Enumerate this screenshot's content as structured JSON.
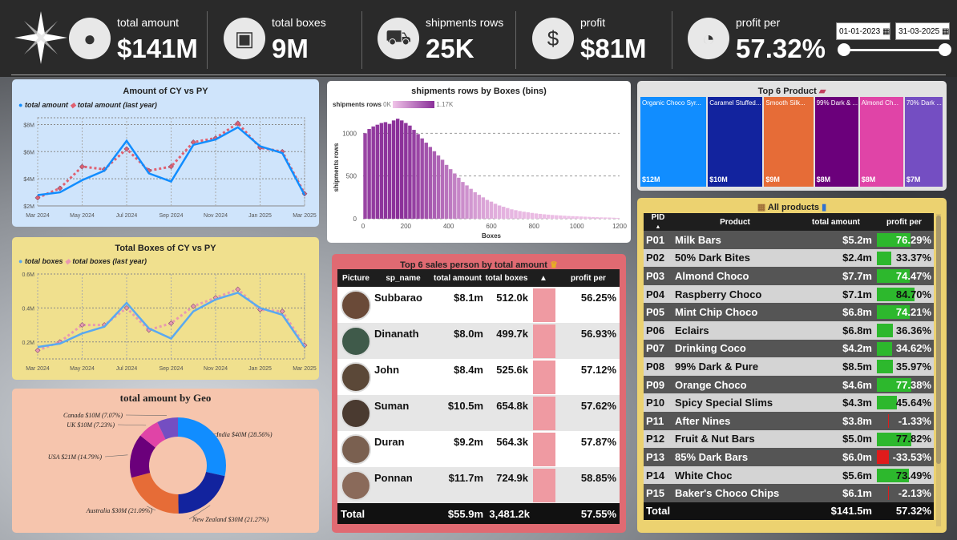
{
  "kpis": [
    {
      "label": "total amount",
      "value": "$141M",
      "icon": "coins-icon"
    },
    {
      "label": "total boxes",
      "value": "9M",
      "icon": "box-icon"
    },
    {
      "label": "shipments rows",
      "value": "25K",
      "icon": "truck-icon"
    },
    {
      "label": "profit",
      "value": "$81M",
      "icon": "money-icon"
    },
    {
      "label": "profit per",
      "value": "57.32%",
      "icon": "gauge-icon"
    }
  ],
  "date_filter": {
    "start": "01-01-2023",
    "end": "31-03-2025"
  },
  "amount_chart": {
    "title": "Amount of CY vs PY",
    "legend": [
      "total amount",
      "total amount (last year)"
    ],
    "y_ticks": [
      "$8M",
      "$6M",
      "$4M",
      "$2M"
    ],
    "x_ticks": [
      "Mar 2024",
      "May 2024",
      "Jul 2024",
      "Sep 2024",
      "Nov 2024",
      "Jan 2025",
      "Mar 2025"
    ]
  },
  "boxes_chart": {
    "title": "Total Boxes of CY vs PY",
    "legend": [
      "total boxes",
      "total boxes (last year)"
    ],
    "y_ticks": [
      "0.6M",
      "0.4M",
      "0.2M"
    ],
    "x_ticks": [
      "Mar 2024",
      "May 2024",
      "Jul 2024",
      "Sep 2024",
      "Nov 2024",
      "Jan 2025",
      "Mar 2025"
    ]
  },
  "geo_chart": {
    "title": "total amount by Geo",
    "labels": [
      "India $40M (28.56%)",
      "New Zealand $30M (21.27%)",
      "Australia $30M (21.09%)",
      "USA $21M (14.79%)",
      "UK $10M (7.23%)",
      "Canada $10M (7.07%)"
    ]
  },
  "hist_chart": {
    "title": "shipments rows by Boxes (bins)",
    "legend_label": "shipments rows",
    "legend_min": "0K",
    "legend_max": "1.17K",
    "ylabel": "shipments rows",
    "xlabel": "Boxes",
    "y_ticks": [
      "1000",
      "500",
      "0"
    ],
    "x_ticks": [
      "0",
      "200",
      "400",
      "600",
      "800",
      "1000",
      "1200"
    ]
  },
  "top_product": {
    "title": "Top 6 Product",
    "items": [
      {
        "name": "Organic Choco Syr...",
        "value": "$12M",
        "color": "#118dff"
      },
      {
        "name": "Caramel Stuffed...",
        "value": "$10M",
        "color": "#12239e"
      },
      {
        "name": "Smooth Silk...",
        "value": "$9M",
        "color": "#e66c37"
      },
      {
        "name": "99% Dark & ...",
        "value": "$8M",
        "color": "#6b007b"
      },
      {
        "name": "Almond Ch...",
        "value": "$8M",
        "color": "#e044a7"
      },
      {
        "name": "70% Dark ...",
        "value": "$7M",
        "color": "#744ec2"
      }
    ]
  },
  "sales_table": {
    "title": "Top 6 sales person by total amount",
    "headers": [
      "Picture",
      "sp_name",
      "total amount",
      "total boxes",
      "",
      "profit per"
    ],
    "rows": [
      {
        "name": "Subbarao",
        "amount": "$8.1m",
        "boxes": "512.0k",
        "profit": "56.25%"
      },
      {
        "name": "Dinanath",
        "amount": "$8.0m",
        "boxes": "499.7k",
        "profit": "56.93%"
      },
      {
        "name": "John",
        "amount": "$8.4m",
        "boxes": "525.6k",
        "profit": "57.12%"
      },
      {
        "name": "Suman",
        "amount": "$10.5m",
        "boxes": "654.8k",
        "profit": "57.62%"
      },
      {
        "name": "Duran",
        "amount": "$9.2m",
        "boxes": "564.3k",
        "profit": "57.87%"
      },
      {
        "name": "Ponnan",
        "amount": "$11.7m",
        "boxes": "724.9k",
        "profit": "58.85%"
      }
    ],
    "total": {
      "label": "Total",
      "amount": "$55.9m",
      "boxes": "3,481.2k",
      "profit": "57.55%"
    }
  },
  "products_table": {
    "title": "All products",
    "headers": [
      "PID",
      "Product",
      "total amount",
      "profit per"
    ],
    "rows": [
      {
        "pid": "P01",
        "name": "Milk Bars",
        "amount": "$5.2m",
        "profit": "76.29%",
        "pct": 76.29
      },
      {
        "pid": "P02",
        "name": "50% Dark Bites",
        "amount": "$2.4m",
        "profit": "33.37%",
        "pct": 33.37
      },
      {
        "pid": "P03",
        "name": "Almond Choco",
        "amount": "$7.7m",
        "profit": "74.47%",
        "pct": 74.47
      },
      {
        "pid": "P04",
        "name": "Raspberry Choco",
        "amount": "$7.1m",
        "profit": "84.70%",
        "pct": 84.7
      },
      {
        "pid": "P05",
        "name": "Mint Chip Choco",
        "amount": "$6.8m",
        "profit": "74.21%",
        "pct": 74.21
      },
      {
        "pid": "P06",
        "name": "Eclairs",
        "amount": "$6.8m",
        "profit": "36.36%",
        "pct": 36.36
      },
      {
        "pid": "P07",
        "name": "Drinking Coco",
        "amount": "$4.2m",
        "profit": "34.62%",
        "pct": 34.62
      },
      {
        "pid": "P08",
        "name": "99% Dark & Pure",
        "amount": "$8.5m",
        "profit": "35.97%",
        "pct": 35.97
      },
      {
        "pid": "P09",
        "name": "Orange Choco",
        "amount": "$4.6m",
        "profit": "77.38%",
        "pct": 77.38
      },
      {
        "pid": "P10",
        "name": "Spicy Special Slims",
        "amount": "$4.3m",
        "profit": "45.64%",
        "pct": 45.64
      },
      {
        "pid": "P11",
        "name": "After Nines",
        "amount": "$3.8m",
        "profit": "-1.33%",
        "pct": -1.33
      },
      {
        "pid": "P12",
        "name": "Fruit & Nut Bars",
        "amount": "$5.0m",
        "profit": "77.82%",
        "pct": 77.82
      },
      {
        "pid": "P13",
        "name": "85% Dark Bars",
        "amount": "$6.0m",
        "profit": "-33.53%",
        "pct": -33.53
      },
      {
        "pid": "P14",
        "name": "White Choc",
        "amount": "$5.6m",
        "profit": "73.49%",
        "pct": 73.49
      },
      {
        "pid": "P15",
        "name": "Baker's Choco Chips",
        "amount": "$6.1m",
        "profit": "-2.13%",
        "pct": -2.13
      }
    ],
    "total": {
      "label": "Total",
      "amount": "$141.5m",
      "profit": "57.32%"
    }
  },
  "chart_data": [
    {
      "type": "line",
      "title": "Amount of CY vs PY",
      "x": [
        "Mar 2024",
        "Apr 2024",
        "May 2024",
        "Jun 2024",
        "Jul 2024",
        "Aug 2024",
        "Sep 2024",
        "Oct 2024",
        "Nov 2024",
        "Dec 2024",
        "Jan 2025",
        "Feb 2025",
        "Mar 2025"
      ],
      "series": [
        {
          "name": "total amount",
          "values": [
            2.8,
            3.0,
            3.9,
            4.6,
            6.8,
            4.4,
            3.8,
            6.5,
            6.9,
            7.8,
            6.4,
            5.9,
            2.8
          ]
        },
        {
          "name": "total amount (last year)",
          "values": [
            2.6,
            3.3,
            4.9,
            4.7,
            6.2,
            4.6,
            4.9,
            6.7,
            7.0,
            8.1,
            6.3,
            6.0,
            2.9
          ]
        }
      ],
      "ylim": [
        2,
        8.5
      ]
    },
    {
      "type": "line",
      "title": "Total Boxes of CY vs PY",
      "x": [
        "Mar 2024",
        "Apr 2024",
        "May 2024",
        "Jun 2024",
        "Jul 2024",
        "Aug 2024",
        "Sep 2024",
        "Oct 2024",
        "Nov 2024",
        "Dec 2024",
        "Jan 2025",
        "Feb 2025",
        "Mar 2025"
      ],
      "series": [
        {
          "name": "total boxes",
          "values": [
            0.17,
            0.19,
            0.25,
            0.29,
            0.43,
            0.28,
            0.22,
            0.38,
            0.45,
            0.49,
            0.4,
            0.36,
            0.17
          ]
        },
        {
          "name": "total boxes (last year)",
          "values": [
            0.15,
            0.2,
            0.3,
            0.3,
            0.4,
            0.27,
            0.31,
            0.41,
            0.46,
            0.51,
            0.39,
            0.38,
            0.18
          ]
        }
      ],
      "ylim": [
        0.1,
        0.6
      ]
    },
    {
      "type": "pie",
      "title": "total amount by Geo",
      "categories": [
        "India",
        "New Zealand",
        "Australia",
        "USA",
        "UK",
        "Canada"
      ],
      "values": [
        28.56,
        21.27,
        21.09,
        14.79,
        7.23,
        7.07
      ],
      "colors": [
        "#118dff",
        "#12239e",
        "#e66c37",
        "#6b007b",
        "#e044a7",
        "#744ec2"
      ]
    },
    {
      "type": "bar",
      "title": "shipments rows by Boxes (bins)",
      "xlabel": "Boxes",
      "ylabel": "shipments rows",
      "values": [
        1000,
        1050,
        1080,
        1100,
        1120,
        1130,
        1110,
        1150,
        1170,
        1150,
        1120,
        1090,
        1040,
        990,
        940,
        890,
        840,
        790,
        740,
        690,
        630,
        580,
        530,
        480,
        430,
        390,
        350,
        310,
        280,
        250,
        220,
        200,
        175,
        155,
        140,
        125,
        110,
        100,
        90,
        82,
        75,
        68,
        62,
        57,
        52,
        48,
        44,
        41,
        38,
        35,
        32,
        30,
        28,
        26,
        24,
        22,
        20,
        18,
        16,
        15,
        14,
        12,
        10
      ],
      "ylim": [
        0,
        1200
      ],
      "xlim": [
        0,
        1200
      ]
    },
    {
      "type": "bar",
      "title": "Top 6 Product",
      "categories": [
        "Organic Choco Syrup",
        "Caramel Stuffed",
        "Smooth Silk",
        "99% Dark & Pure",
        "Almond Choco",
        "70% Dark"
      ],
      "values": [
        12,
        10,
        9,
        8,
        8,
        7
      ]
    }
  ]
}
